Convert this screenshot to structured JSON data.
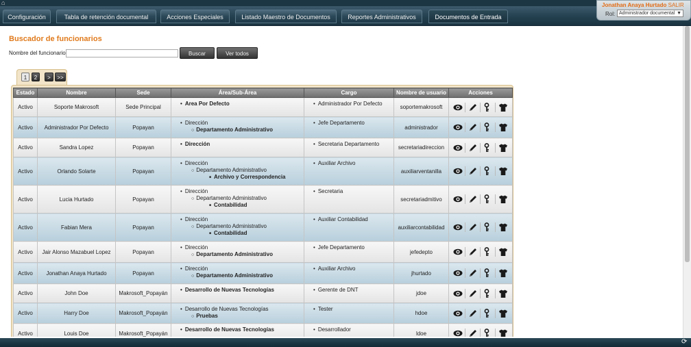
{
  "nav": {
    "items": [
      "Configuración",
      "Tabla de retención documental",
      "Acciones Especiales",
      "Listado Maestro de Documentos",
      "Reportes Administrativos",
      "Documentos de Entrada"
    ],
    "active_index": 5
  },
  "user": {
    "name": "Jonathan Anaya Hurtado",
    "logout": "SALIR",
    "role_label": "Rol:",
    "role_value": "Administrador documental"
  },
  "page": {
    "title": "Buscador de funcionarios",
    "search_label": "Nombre del funcionario",
    "search_value": "",
    "buscar_label": "Buscar",
    "ver_todos_label": "Ver todos"
  },
  "pager": {
    "pages": [
      "1",
      "2"
    ],
    "selected": "1",
    "next": ">",
    "last": ">>"
  },
  "table": {
    "headers": [
      "Estado",
      "Nombre",
      "Sede",
      "Área/Sub-Área",
      "Cargo",
      "Nombre de usuario",
      "Acciones"
    ],
    "rows": [
      {
        "estado": "Activo",
        "nombre": "Soporte Makrosoft",
        "sede": "Sede Principal",
        "area": [
          "Area Por Defecto"
        ],
        "cargo": "Administrador Por Defecto",
        "usuario": "soportemakrosoft"
      },
      {
        "estado": "Activo",
        "nombre": "Administrador Por Defecto",
        "sede": "Popayan",
        "area": [
          "Dirección",
          "Departamento Administrativo"
        ],
        "cargo": "Jefe Departamento",
        "usuario": "administrador"
      },
      {
        "estado": "Activo",
        "nombre": "Sandra Lopez",
        "sede": "Popayan",
        "area": [
          "Dirección"
        ],
        "cargo": "Secretaria Departamento",
        "usuario": "secretariadireccion"
      },
      {
        "estado": "Activo",
        "nombre": "Orlando Solarte",
        "sede": "Popayan",
        "area": [
          "Dirección",
          "Departamento Administrativo",
          "Archivo y Correspondencia"
        ],
        "cargo": "Auxiliar Archivo",
        "usuario": "auxiliarventanilla"
      },
      {
        "estado": "Activo",
        "nombre": "Lucia Hurtado",
        "sede": "Popayan",
        "area": [
          "Dirección",
          "Departamento Administrativo",
          "Contabilidad"
        ],
        "cargo": "Secretaria",
        "usuario": "secretariadmitivo"
      },
      {
        "estado": "Activo",
        "nombre": "Fabian Mera",
        "sede": "Popayan",
        "area": [
          "Dirección",
          "Departamento Administrativo",
          "Contabilidad"
        ],
        "cargo": "Auxiliar Contabilidad",
        "usuario": "auxiliarcontabilidad"
      },
      {
        "estado": "Activo",
        "nombre": "Jair Alonso Mazabuel Lopez",
        "sede": "Popayan",
        "area": [
          "Dirección",
          "Departamento Administrativo"
        ],
        "cargo": "Jefe Departamento",
        "usuario": "jefedepto"
      },
      {
        "estado": "Activo",
        "nombre": "Jonathan Anaya Hurtado",
        "sede": "Popayan",
        "area": [
          "Dirección",
          "Departamento Administrativo"
        ],
        "cargo": "Auxiliar Archivo",
        "usuario": "jhurtado"
      },
      {
        "estado": "Activo",
        "nombre": "John Doe",
        "sede": "Makrosoft_Popayán",
        "area": [
          "Desarrollo de Nuevas Tecnologías"
        ],
        "cargo": "Gerente de DNT",
        "usuario": "jdoe"
      },
      {
        "estado": "Activo",
        "nombre": "Harry Doe",
        "sede": "Makrosoft_Popayán",
        "area": [
          "Desarrollo de Nuevas Tecnologías",
          "Pruebas"
        ],
        "cargo": "Tester",
        "usuario": "hdoe"
      },
      {
        "estado": "Activo",
        "nombre": "Louis Doe",
        "sede": "Makrosoft_Popayán",
        "area": [
          "Desarrollo de Nuevas Tecnologías"
        ],
        "cargo": "Desarrollador",
        "usuario": "ldoe"
      }
    ],
    "actions": [
      "eye-icon",
      "pencil-icon",
      "key-icon",
      "shirt-icon"
    ]
  },
  "colors": {
    "accent": "#e07a1c",
    "nav": "#23404f"
  }
}
